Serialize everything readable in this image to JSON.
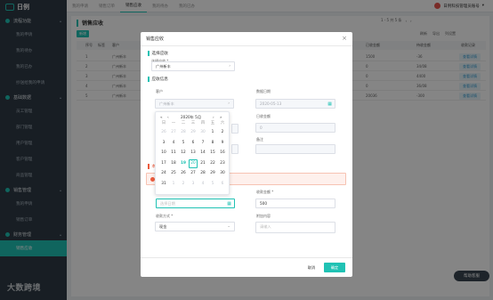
{
  "sidebar": {
    "logo": "日例",
    "groups": [
      {
        "label": "流程功能",
        "items": [
          "我的申请",
          "我的待办",
          "我的已办",
          "抄送给我的申请"
        ]
      },
      {
        "label": "基础数据",
        "items": [
          "员工管理",
          "部门管理",
          "用户管理",
          "客户管理",
          "商品管理"
        ]
      },
      {
        "label": "销售管理",
        "items": [
          "我的申请",
          "销售订单"
        ]
      },
      {
        "label": "财务管理",
        "items": [
          "销售应收"
        ]
      }
    ],
    "watermark": "大数跨境"
  },
  "topbar": {
    "tabs": [
      "我的申请",
      "销售订单",
      "销售应收",
      "我的待办",
      "我的已办"
    ],
    "active_tab": 2,
    "user": "日例科技管理员账号"
  },
  "page": {
    "title": "销售应收",
    "add_label": "新增",
    "pager": "1 - 5 共 5 条",
    "tools": [
      "刷新",
      "导出",
      "列设置"
    ],
    "columns": [
      "序号",
      "标签",
      "客户",
      "已收金额",
      "待收金额",
      "收款记录"
    ],
    "rows": [
      {
        "no": "1",
        "customer": "广州新丰",
        "received": "1500",
        "pending": "-36",
        "action": "查看详情"
      },
      {
        "no": "2",
        "customer": "广州新丰",
        "received": "0",
        "pending": "34/08",
        "action": "查看详情"
      },
      {
        "no": "3",
        "customer": "广州新丰",
        "received": "0",
        "pending": "4400",
        "action": "查看详情"
      },
      {
        "no": "4",
        "customer": "广州新丰",
        "received": "0",
        "pending": "36/08",
        "action": "查看详情"
      },
      {
        "no": "5",
        "customer": "广州新丰",
        "received": "20036",
        "pending": "-300",
        "action": "查看详情"
      }
    ],
    "help_label": "帮助客服"
  },
  "modal": {
    "title": "销售应收",
    "section1": "选择应收",
    "order_label": "选择应收 *",
    "order_value": "广州新丰",
    "section2": "应收信息",
    "customer_label": "客户",
    "customer_value": "广州新丰",
    "date_label": "数据日期",
    "date_value": "2020-05-13",
    "amount_label": "日收金额",
    "amount_value": "0",
    "remark_label": "备注",
    "section3": "本",
    "collect_date_placeholder": "选择日期",
    "collect_amount_label": "收款金额 *",
    "collect_amount_value": "500",
    "method_label": "收款方式 *",
    "method_value": "现金",
    "attach_label": "附加内容",
    "attach_placeholder": "请输入",
    "cancel": "取消",
    "ok": "确定"
  },
  "datepicker": {
    "title": "2020年 5月",
    "nav": [
      "«",
      "‹",
      "›",
      "»"
    ],
    "weekdays": [
      "日",
      "一",
      "二",
      "三",
      "四",
      "五",
      "六"
    ],
    "days": [
      [
        "26",
        "27",
        "28",
        "29",
        "30",
        "1",
        "2"
      ],
      [
        "3",
        "4",
        "5",
        "6",
        "7",
        "8",
        "9"
      ],
      [
        "10",
        "11",
        "12",
        "13",
        "14",
        "15",
        "16"
      ],
      [
        "17",
        "18",
        "19",
        "20",
        "21",
        "22",
        "23"
      ],
      [
        "24",
        "25",
        "26",
        "27",
        "28",
        "29",
        "30"
      ],
      [
        "31",
        "1",
        "2",
        "3",
        "4",
        "5",
        "6"
      ]
    ],
    "selected_day": "20",
    "today_day": "19"
  }
}
